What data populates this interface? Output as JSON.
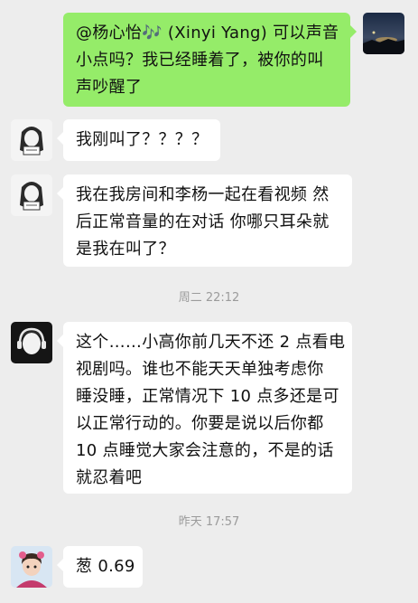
{
  "colors": {
    "background": "#ededed",
    "sent_bubble": "#95ec69",
    "received_bubble": "#ffffff",
    "timestamp_text": "#9b9b9b"
  },
  "messages": [
    {
      "direction": "sent",
      "avatar_icon": "night-landscape-avatar",
      "lines": [
        "@杨心怡🎶 (Xinyi Yang) 可以声音",
        "小点吗？我已经睡着了，被你的叫",
        "声吵醒了"
      ]
    },
    {
      "direction": "received",
      "avatar_icon": "girl-sketch-avatar",
      "lines": [
        "我刚叫了？？？？"
      ]
    },
    {
      "direction": "received",
      "avatar_icon": "girl-sketch-avatar",
      "lines": [
        "我在我房间和李杨一起在看视频 然",
        "后正常音量的在对话 你哪只耳朵就",
        "是我在叫了？"
      ]
    },
    {
      "direction": "received",
      "avatar_icon": "headphones-boy-avatar",
      "lines": [
        "这个……小高你前几天不还 2 点看电",
        "视剧吗。谁也不能天天单独考虑你",
        "睡没睡，正常情况下 10 点多还是可",
        "以正常行动的。你要是说以后你都",
        "10 点睡觉大家会注意的，不是的话",
        "就忍着吧"
      ]
    },
    {
      "direction": "received",
      "avatar_icon": "child-photo-avatar",
      "lines": [
        "葱 0.69"
      ]
    }
  ],
  "timestamps": [
    "周二 22:12",
    "昨天 17:57"
  ]
}
